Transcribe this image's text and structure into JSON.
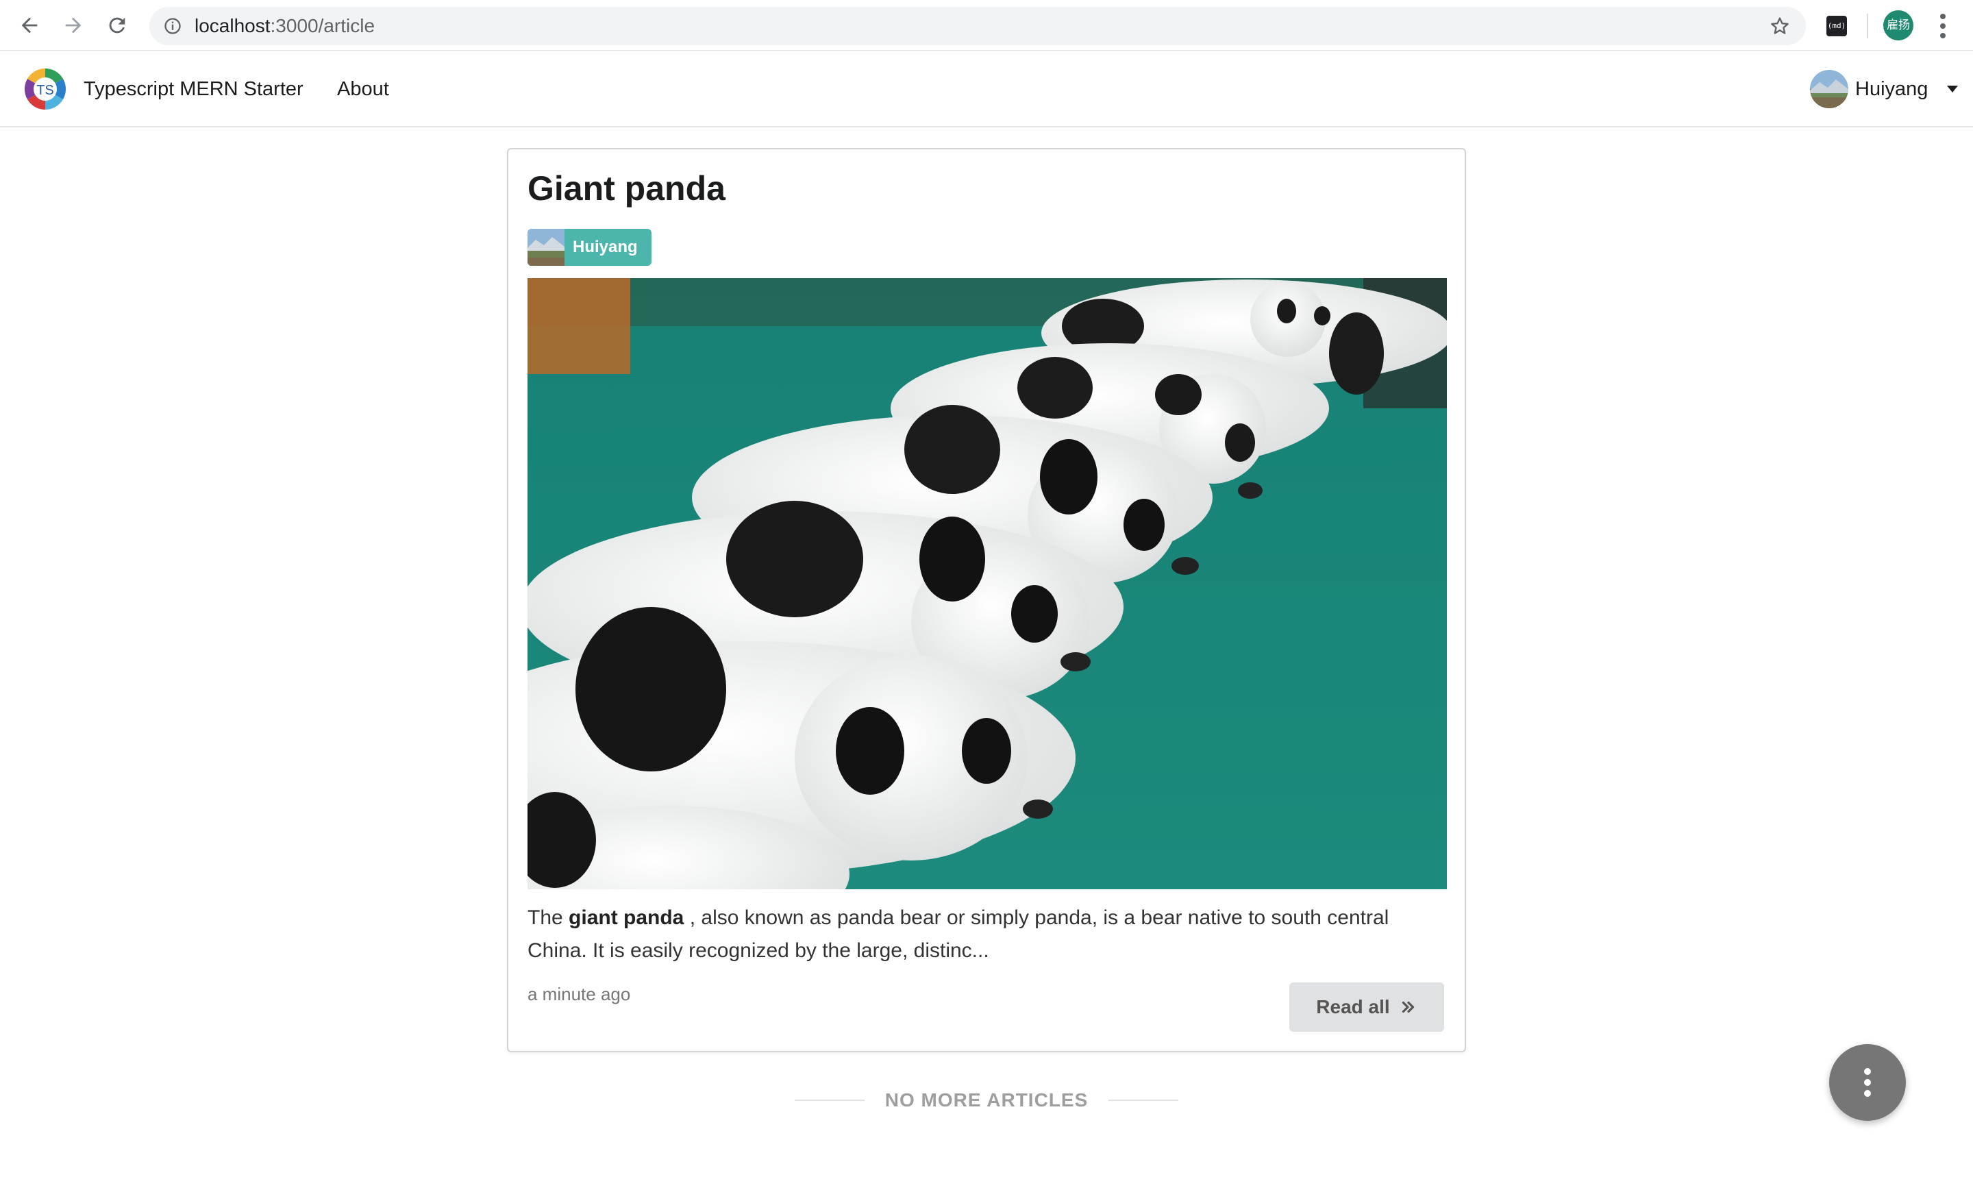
{
  "browser": {
    "url_host": "localhost",
    "url_path": ":3000/article",
    "ext_label": "(md)",
    "profile_initials": "雇扬"
  },
  "header": {
    "app_title": "Typescript MERN Starter",
    "logo_text": "TS",
    "nav_about": "About",
    "user_name": "Huiyang"
  },
  "article": {
    "title": "Giant panda",
    "author": "Huiyang",
    "excerpt_pre": "The ",
    "excerpt_bold": "giant panda",
    "excerpt_post": " , also known as panda bear or simply panda, is a bear native to south central China. It is easily recognized by the large, distinc...",
    "timestamp": "a minute ago",
    "read_all_label": "Read all"
  },
  "footer": {
    "end_text": "NO MORE ARTICLES"
  },
  "colors": {
    "author_label_bg": "#4db6ac",
    "fab_bg": "#767676",
    "image_backdrop": "#1e8578"
  },
  "icons": {
    "back": "arrow-left-icon",
    "forward": "arrow-right-icon",
    "reload": "reload-icon",
    "info": "info-icon",
    "bookmark": "star-icon",
    "menu": "vertical-dots-icon",
    "caret": "caret-down-icon",
    "read_all": "double-chevron-right-icon",
    "fab": "vertical-dots-icon"
  }
}
